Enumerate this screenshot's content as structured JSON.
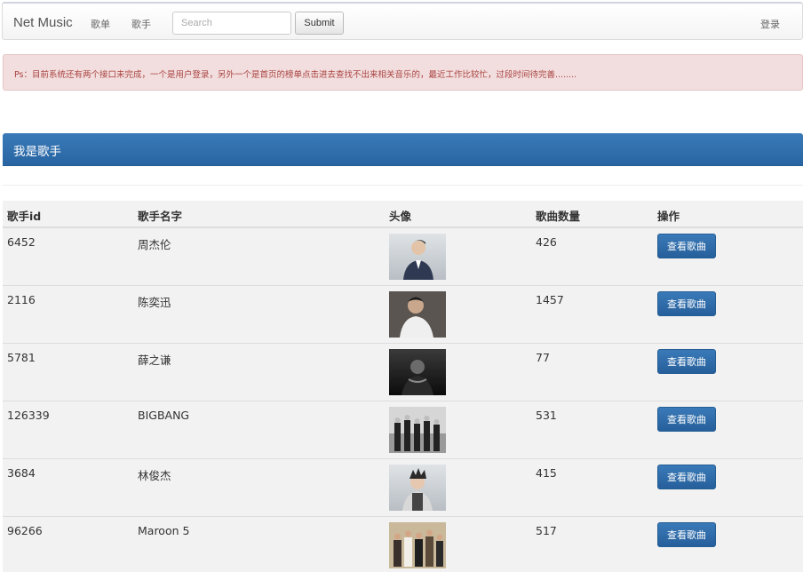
{
  "navbar": {
    "brand": "Net Music",
    "links": [
      "歌单",
      "歌手"
    ],
    "search_placeholder": "Search",
    "submit_label": "Submit",
    "login_label": "登录"
  },
  "alert": {
    "text": "Ps：目前系统还有两个接口未完成，一个是用户登录，另外一个是首页的榜单点击进去查找不出来相关音乐的，最近工作比较忙，过段时间待完善........"
  },
  "panel": {
    "title": "我是歌手"
  },
  "table": {
    "headers": [
      "歌手id",
      "歌手名字",
      "头像",
      "歌曲数量",
      "操作"
    ],
    "action_label": "查看歌曲",
    "rows": [
      {
        "id": "6452",
        "name": "周杰伦",
        "count": "426",
        "avatar": "avatar-photo"
      },
      {
        "id": "2116",
        "name": "陈奕迅",
        "count": "1457",
        "avatar": "avatar-photo"
      },
      {
        "id": "5781",
        "name": "薛之谦",
        "count": "77",
        "avatar": "avatar-photo"
      },
      {
        "id": "126339",
        "name": "BIGBANG",
        "count": "531",
        "avatar": "group-photo"
      },
      {
        "id": "3684",
        "name": "林俊杰",
        "count": "415",
        "avatar": "avatar-photo"
      },
      {
        "id": "96266",
        "name": "Maroon 5",
        "count": "517",
        "avatar": "group-photo"
      }
    ]
  },
  "colors": {
    "primary": "#2d6ca8",
    "alert_bg": "#f2dede",
    "alert_text": "#a94442",
    "table_bg": "#f2f2f2"
  }
}
